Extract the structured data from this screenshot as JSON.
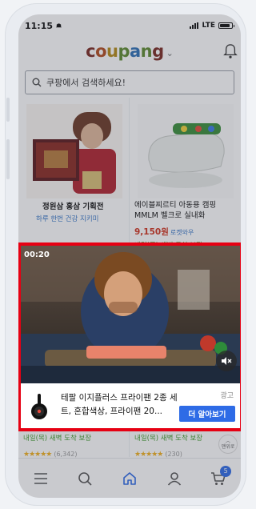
{
  "status": {
    "time": "11:15",
    "network": "LTE"
  },
  "header": {
    "logo": [
      "c",
      "o",
      "u",
      "p",
      "a",
      "n",
      "g"
    ],
    "logo_text": "coupang"
  },
  "search": {
    "placeholder": "쿠팡에서 검색하세요!"
  },
  "products": [
    {
      "name": "정원삼 홍삼 기획전",
      "subtitle": "하루 한번 건강 지키미",
      "icon": "ginseng-gift-box-image"
    },
    {
      "name": "에이블찌르티 아동용 캠핑 MMLM 벨크로 실내화",
      "price": "9,150원",
      "rocket": "로켓와우",
      "delivery": "내일(목) 새벽 도착 보장",
      "icon": "kids-slipper-image"
    }
  ],
  "ad": {
    "video_time": "00:20",
    "title": "테팔 이지플러스 프라이팬 2종 세트, 혼합색상, 프라이팬 20...",
    "label": "광고",
    "cta": "더 알아보기"
  },
  "lower": [
    {
      "delivery": "내일(목) 새벽 도착 보장",
      "stars": "★★★★★",
      "reviews": "(6,342)"
    },
    {
      "delivery": "내일(목) 새벽 도착 보장",
      "stars": "★★★★★",
      "reviews": "(230)",
      "to_top": "맨위로"
    }
  ],
  "tabbar": {
    "items": [
      "menu-icon",
      "search-icon",
      "home-icon",
      "my-coupang-icon",
      "cart-icon"
    ],
    "cart_count": "5"
  },
  "colors": {
    "ad_border": "#e60013",
    "cta": "#2e6be6",
    "price": "#d0331e",
    "delivery": "#3f9a2c"
  }
}
